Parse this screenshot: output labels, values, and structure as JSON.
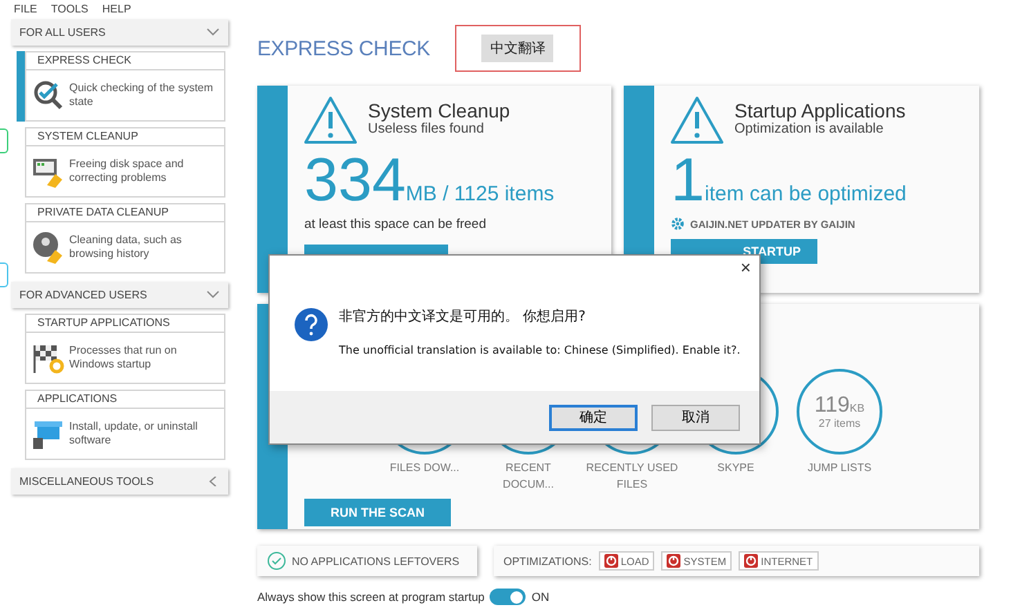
{
  "menu": [
    "FILE",
    "TOOLS",
    "HELP"
  ],
  "sidebar": {
    "sections": [
      {
        "title": "FOR ALL USERS",
        "expanded": true,
        "items": [
          {
            "title": "EXPRESS CHECK",
            "description": "Quick checking of the system state",
            "selected": true
          },
          {
            "title": "SYSTEM CLEANUP",
            "description": "Freeing disk space and correcting problems",
            "selected": false
          },
          {
            "title": "PRIVATE DATA CLEANUP",
            "description": "Cleaning data, such as browsing history",
            "selected": false
          }
        ]
      },
      {
        "title": "FOR ADVANCED USERS",
        "expanded": true,
        "items": [
          {
            "title": "STARTUP APPLICATIONS",
            "description": "Processes that run on Windows startup",
            "selected": false
          },
          {
            "title": "APPLICATIONS",
            "description": "Install, update, or uninstall software",
            "selected": false
          }
        ]
      },
      {
        "title": "MISCELLANEOUS TOOLS",
        "expanded": false
      }
    ]
  },
  "main": {
    "title": "EXPRESS CHECK",
    "translate_button": "中文翻译",
    "cleanup_card": {
      "title": "System Cleanup",
      "subtitle": "Useless files found",
      "big_number": "334",
      "unit_text": "MB / 1125 items",
      "note": "at least this space can be freed"
    },
    "startup_card": {
      "title": "Startup Applications",
      "subtitle": "Optimization is available",
      "big_number": "1",
      "unit_text": "item can be optimized",
      "app_name": "GAIJIN.NET UPDATER BY GAIJIN",
      "button": "STARTUP"
    },
    "scan_card": {
      "items": [
        {
          "label": "FILES DOW..."
        },
        {
          "label": "RECENT DOCUM..."
        },
        {
          "label": "RECENTLY USED FILES"
        },
        {
          "label": "SKYPE"
        },
        {
          "label": "JUMP LISTS",
          "value": "119",
          "unit": "KB",
          "sub": "27 items"
        }
      ],
      "button": "RUN THE SCAN"
    },
    "leftovers": "NO APPLICATIONS LEFTOVERS",
    "optimizations": {
      "label": "OPTIMIZATIONS:",
      "buttons": [
        "LOAD",
        "SYSTEM",
        "INTERNET"
      ]
    },
    "startup_toggle": {
      "label": "Always show this screen at program startup",
      "on": true,
      "state_text": "ON"
    }
  },
  "dialog": {
    "close": "×",
    "question": "非官方的中文译文是可用的。 你想启用?",
    "message": "The unofficial translation is available to: Chinese (Simplified). Enable it?.",
    "buttons": [
      {
        "label": "确定",
        "selected": true
      },
      {
        "label": "取消",
        "selected": false
      }
    ]
  }
}
